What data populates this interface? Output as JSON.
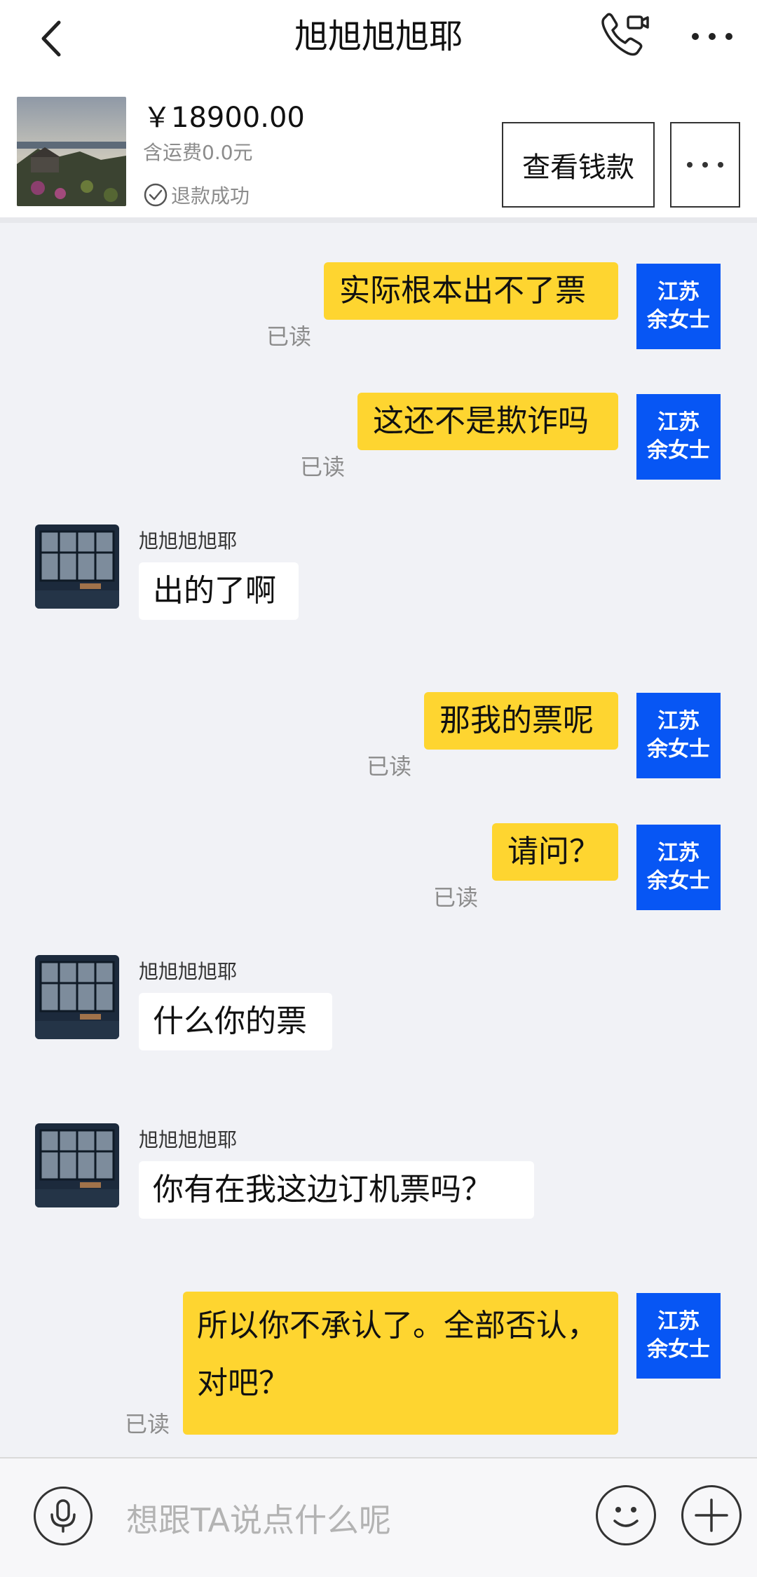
{
  "header": {
    "title": "旭旭旭旭耶"
  },
  "product": {
    "price": "￥18900.00",
    "shipping": "含运费0.0元",
    "status": "退款成功",
    "view_button": "查看钱款"
  },
  "me": {
    "avatar_line1": "江苏",
    "avatar_line2": "余女士"
  },
  "other": {
    "name": "旭旭旭旭耶"
  },
  "read_label": "已读",
  "messages": [
    {
      "from": "me",
      "text": "实际根本出不了票"
    },
    {
      "from": "me",
      "text": "这还不是欺诈吗"
    },
    {
      "from": "other",
      "text": "出的了啊"
    },
    {
      "from": "me",
      "text": "那我的票呢"
    },
    {
      "from": "me",
      "text": "请问？"
    },
    {
      "from": "other",
      "text": "什么你的票"
    },
    {
      "from": "other",
      "text": "你有在我这边订机票吗？"
    },
    {
      "from": "me",
      "text": "所以你不承认了。全部否认，对吧？"
    }
  ],
  "input": {
    "placeholder": "想跟TA说点什么呢"
  },
  "colors": {
    "bubble_out": "#fed530",
    "avatar_me": "#0756f4",
    "background": "#f1f2f6"
  }
}
